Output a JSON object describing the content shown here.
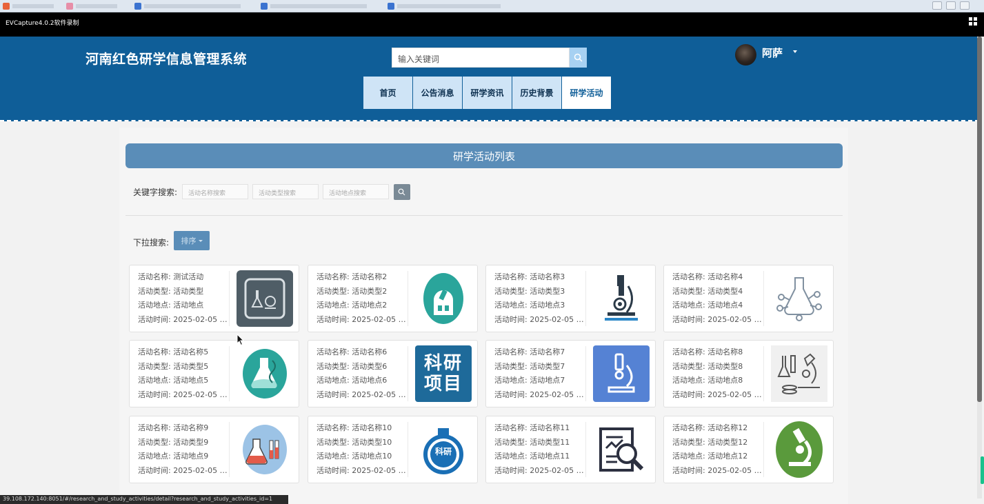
{
  "capture": {
    "title": "EVCapture4.0.2软件录制"
  },
  "site": {
    "title": "河南红色研学信息管理系统",
    "search_placeholder": "输入关键词",
    "username": "阿萨"
  },
  "nav": [
    "首页",
    "公告消息",
    "研学资讯",
    "历史背景",
    "研学活动"
  ],
  "nav_active": "研学活动",
  "list": {
    "title": "研学活动列表",
    "keyword_label": "关键字搜索:",
    "placeholders": [
      "活动名称搜索",
      "活动类型搜索",
      "活动地点搜索"
    ],
    "dropdown_label": "下拉搜索:",
    "sort_label": "排序"
  },
  "cards": [
    {
      "name": "活动名称: 测试活动",
      "type": "活动类型: 活动类型",
      "place": "活动地点: 活动地点",
      "time": "活动时间: 2025-02-05 1...",
      "icon": "lab-equipment-icon"
    },
    {
      "name": "活动名称: 活动名称2",
      "type": "活动类型: 活动类型2",
      "place": "活动地点: 活动地点2",
      "time": "活动时间: 2025-02-05 1...",
      "icon": "observatory-icon"
    },
    {
      "name": "活动名称: 活动名称3",
      "type": "活动类型: 活动类型3",
      "place": "活动地点: 活动地点3",
      "time": "活动时间: 2025-02-05 1...",
      "icon": "microscope-icon"
    },
    {
      "name": "活动名称: 活动名称4",
      "type": "活动类型: 活动类型4",
      "place": "活动地点: 活动地点4",
      "time": "活动时间: 2025-02-05 1...",
      "icon": "molecule-flask-icon"
    },
    {
      "name": "活动名称: 活动名称5",
      "type": "活动类型: 活动类型5",
      "place": "活动地点: 活动地点5",
      "time": "活动时间: 2025-02-05 1...",
      "icon": "dna-flask-icon"
    },
    {
      "name": "活动名称: 活动名称6",
      "type": "活动类型: 活动类型6",
      "place": "活动地点: 活动地点6",
      "time": "活动时间: 2025-02-05 1...",
      "icon": "research-project-icon",
      "icon_text": "科研项目"
    },
    {
      "name": "活动名称: 活动名称7",
      "type": "活动类型: 活动类型7",
      "place": "活动地点: 活动地点7",
      "time": "活动时间: 2025-02-05 1...",
      "icon": "microscope-blue-icon"
    },
    {
      "name": "活动名称: 活动名称8",
      "type": "活动类型: 活动类型8",
      "place": "活动地点: 活动地点8",
      "time": "活动时间: 2025-02-05 1...",
      "icon": "lab-sketch-icon"
    },
    {
      "name": "活动名称: 活动名称9",
      "type": "活动类型: 活动类型9",
      "place": "活动地点: 活动地点9",
      "time": "活动时间: 2025-02-05 1...",
      "icon": "test-tubes-icon"
    },
    {
      "name": "活动名称: 活动名称10",
      "type": "活动类型: 活动类型10",
      "place": "活动地点: 活动地点10",
      "time": "活动时间: 2025-02-05 1...",
      "icon": "research-flask-icon",
      "icon_text": "科研"
    },
    {
      "name": "活动名称: 活动名称11",
      "type": "活动类型: 活动类型11",
      "place": "活动地点: 活动地点11",
      "time": "活动时间: 2025-02-05 1...",
      "icon": "document-search-icon"
    },
    {
      "name": "活动名称: 活动名称12",
      "type": "活动类型: 活动类型12",
      "place": "活动地点: 活动地点12",
      "time": "活动时间: 2025-02-05 1...",
      "icon": "microscope-green-icon"
    }
  ],
  "status_url": "39.108.172.140:8051/#/research_and_study_activities/detail?research_and_study_activities_id=1",
  "colors": {
    "header": "#0f5e98",
    "nav": "#cfe4f6",
    "list_title": "#5a8db8"
  }
}
